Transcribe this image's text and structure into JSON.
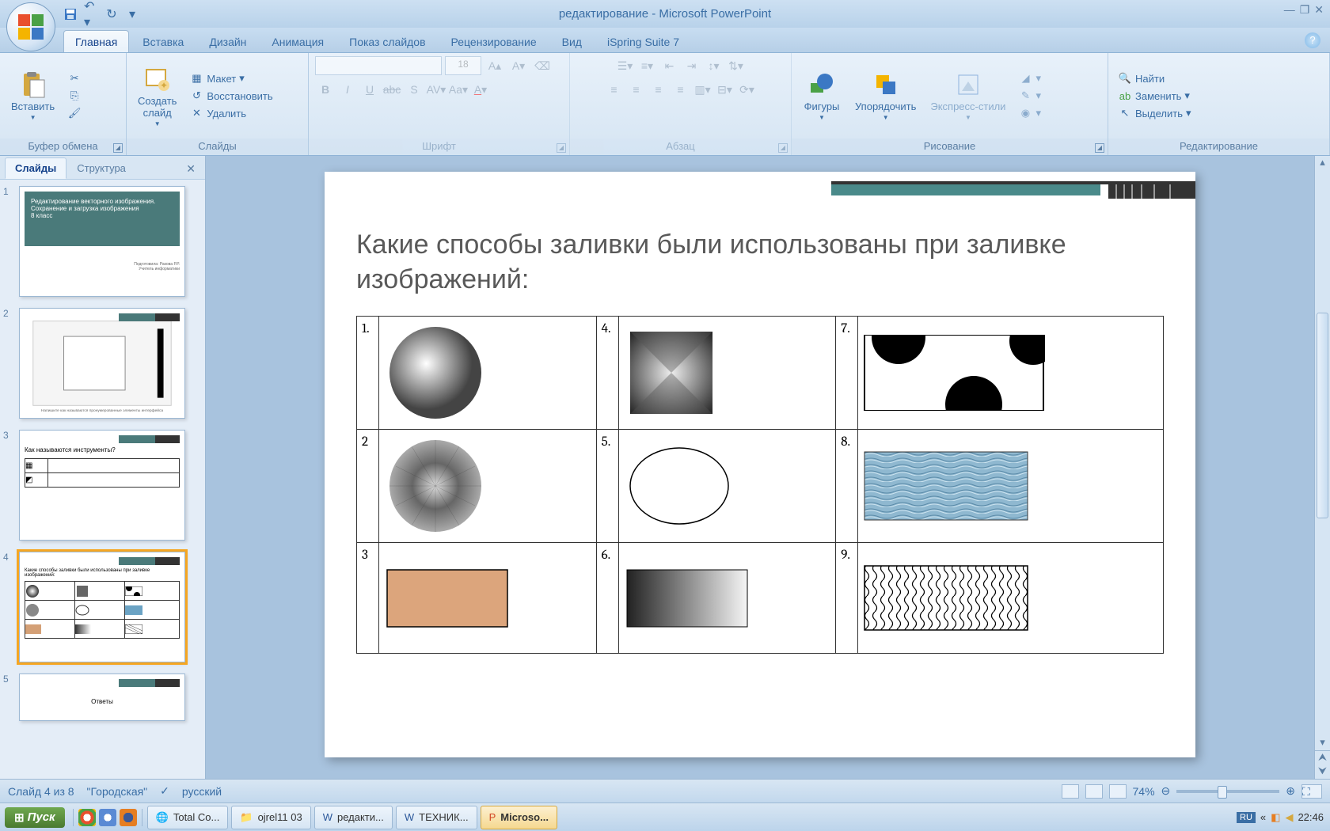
{
  "title": "редактирование - Microsoft PowerPoint",
  "tabs": [
    "Главная",
    "Вставка",
    "Дизайн",
    "Анимация",
    "Показ слайдов",
    "Рецензирование",
    "Вид",
    "iSpring Suite 7"
  ],
  "active_tab": 0,
  "ribbon": {
    "clipboard": {
      "label": "Буфер обмена",
      "paste": "Вставить"
    },
    "slides": {
      "label": "Слайды",
      "new": "Создать\nслайд",
      "layout": "Макет",
      "reset": "Восстановить",
      "delete": "Удалить"
    },
    "font": {
      "label": "Шрифт",
      "size": "18"
    },
    "paragraph": {
      "label": "Абзац"
    },
    "drawing": {
      "label": "Рисование",
      "shapes": "Фигуры",
      "arrange": "Упорядочить",
      "quickstyles": "Экспресс-стили"
    },
    "editing": {
      "label": "Редактирование",
      "find": "Найти",
      "replace": "Заменить",
      "select": "Выделить"
    }
  },
  "panel": {
    "tabs": [
      "Слайды",
      "Структура"
    ],
    "active": 0
  },
  "thumbs": [
    {
      "n": "1",
      "title": "Редактирование векторного изображения. Сохранение и загрузка изображения\n8 класс"
    },
    {
      "n": "2",
      "title": ""
    },
    {
      "n": "3",
      "title": "Как называются инструменты?"
    },
    {
      "n": "4",
      "title": "Какие способы заливки были использованы при заливке изображений:"
    },
    {
      "n": "5",
      "title": "Ответы"
    }
  ],
  "current_slide_index": 3,
  "slide": {
    "title": "Какие способы заливки были использованы при заливке изображений:",
    "cells": [
      "1.",
      "4.",
      "7.",
      "2",
      "5.",
      "8.",
      "3",
      "6.",
      "9."
    ]
  },
  "status": {
    "slide": "Слайд 4 из 8",
    "theme": "\"Городская\"",
    "lang": "русский",
    "zoom": "74%"
  },
  "taskbar": {
    "start": "Пуск",
    "items": [
      "Total Co...",
      "ojrel11 03",
      "редакти...",
      "ТЕХНИК...",
      "Microso..."
    ],
    "active_item": 4,
    "lang": "RU",
    "time": "22:46"
  }
}
